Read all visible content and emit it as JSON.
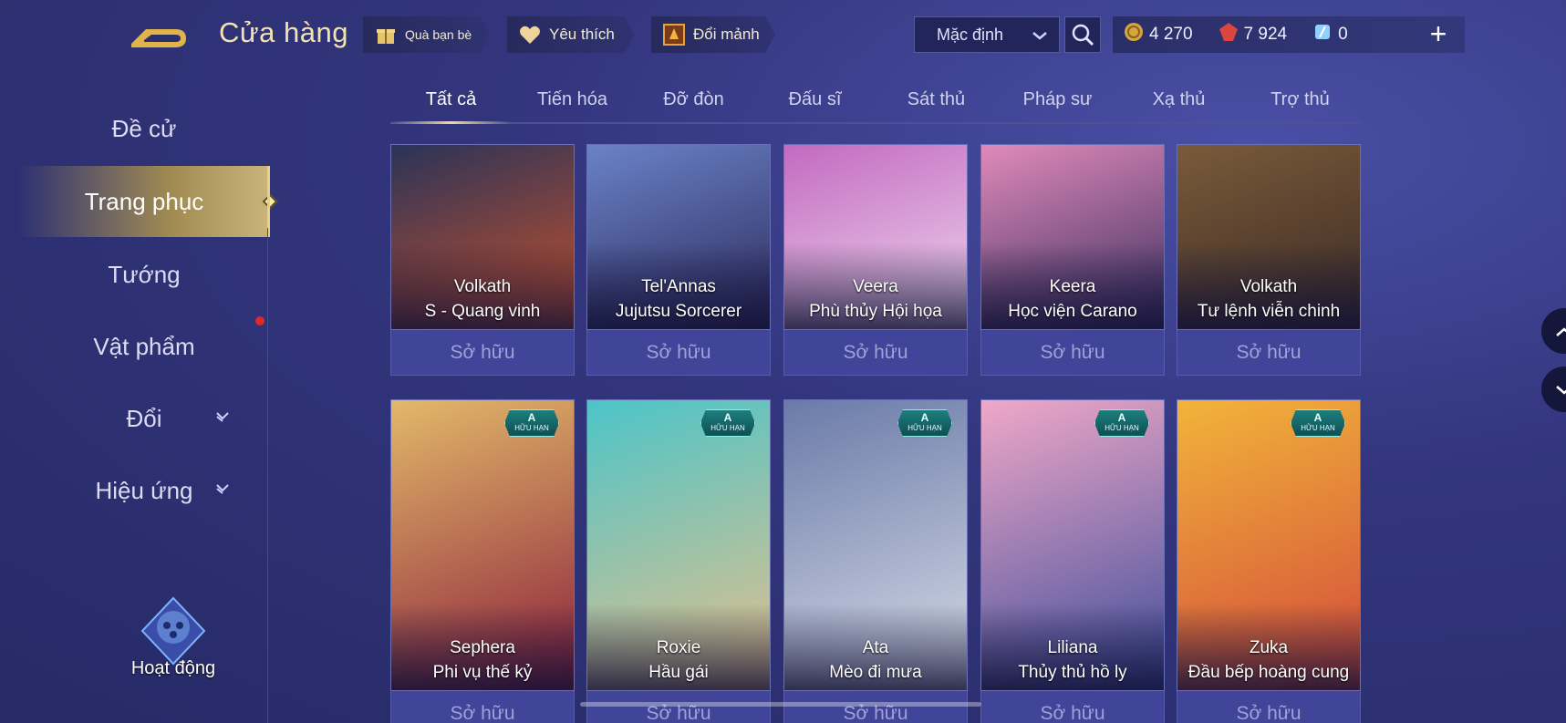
{
  "header": {
    "title": "Cửa hàng",
    "gift_label": "Quà bạn bè",
    "fav_label": "Yêu thích",
    "frag_label": "Đổi mảnh",
    "sort_value": "Mặc định",
    "gold": "4 270",
    "coupons": "7 924",
    "tokens": "0"
  },
  "sidebar": {
    "items": [
      {
        "label": "Đề cử"
      },
      {
        "label": "Trang phục"
      },
      {
        "label": "Tướng"
      },
      {
        "label": "Vật phẩm"
      },
      {
        "label": "Đổi"
      },
      {
        "label": "Hiệu ứng"
      }
    ],
    "activity_label": "Hoạt động"
  },
  "tabs": [
    "Tất cả",
    "Tiến hóa",
    "Đỡ đòn",
    "Đấu sĩ",
    "Sát thủ",
    "Pháp sư",
    "Xạ thủ",
    "Trợ thủ"
  ],
  "owned_label": "Sở hữu",
  "badge": {
    "grade": "A",
    "text": "HỮU HẠN"
  },
  "cards": [
    {
      "hero": "Volkath",
      "skin": "S - Quang vinh",
      "bg": [
        "#2a3358",
        "#c7512b"
      ]
    },
    {
      "hero": "Tel'Annas",
      "skin": "Jujutsu Sorcerer",
      "bg": [
        "#6a82c8",
        "#2c2a5a"
      ]
    },
    {
      "hero": "Veera",
      "skin": "Phù thủy Hội họa",
      "bg": [
        "#c26ac0",
        "#f0d8ee"
      ]
    },
    {
      "hero": "Keera",
      "skin": "Học viện Carano",
      "bg": [
        "#e08abb",
        "#3a2f5e"
      ]
    },
    {
      "hero": "Volkath",
      "skin": "Tư lệnh viễn chinh",
      "bg": [
        "#7a5a3a",
        "#3a2a24"
      ]
    },
    {
      "hero": "Sephera",
      "skin": "Phi vụ thế kỷ",
      "bg": [
        "#e3b96a",
        "#8a1e3a"
      ]
    },
    {
      "hero": "Roxie",
      "skin": "Hầu gái",
      "bg": [
        "#4cc4c8",
        "#e7c08a"
      ]
    },
    {
      "hero": "Ata",
      "skin": "Mèo đi mưa",
      "bg": [
        "#6a7aa8",
        "#d8dde8"
      ]
    },
    {
      "hero": "Liliana",
      "skin": "Thủy thủ hồ ly",
      "bg": [
        "#f0a8c8",
        "#3c4c9a"
      ]
    },
    {
      "hero": "Zuka",
      "skin": "Đầu bếp hoàng cung",
      "bg": [
        "#f2b43a",
        "#d2483a"
      ]
    }
  ]
}
